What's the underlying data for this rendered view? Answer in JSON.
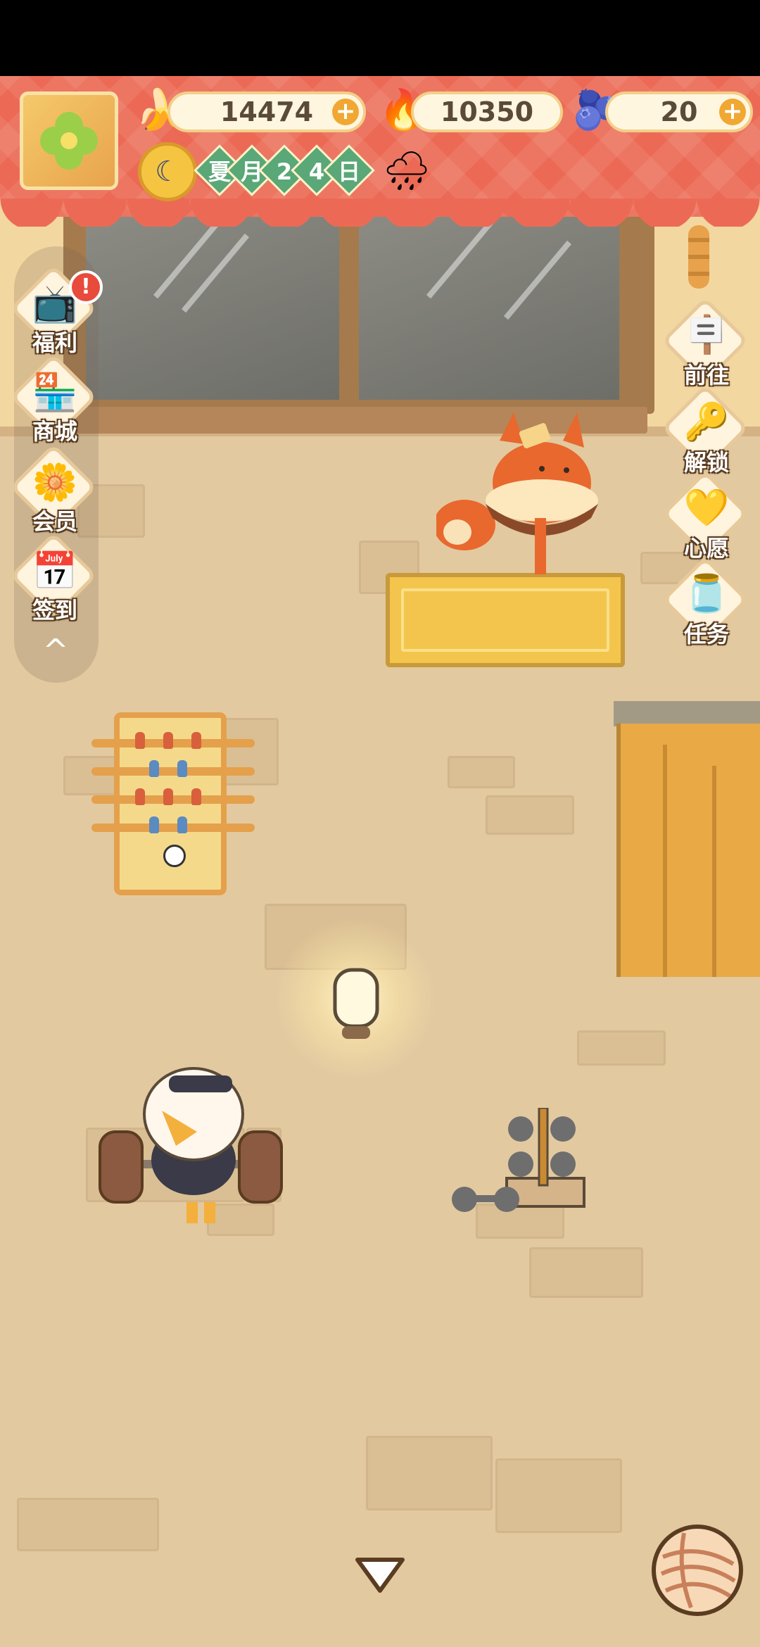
{
  "hud": {
    "bananas": "14474",
    "flames": "10350",
    "gems": "20",
    "plus_symbol": "+",
    "date": {
      "season": "夏",
      "month_word": "月",
      "day_a": "2",
      "day_b": "4",
      "day_word": "日"
    },
    "icons": {
      "avatar": "clover-flower-icon",
      "banana": "banana-icon",
      "flame": "flame-icon",
      "gem": "blue-banana-icon",
      "clock": "moon-clock-icon",
      "weather": "rain-cloud-icon"
    }
  },
  "left_menu": {
    "items": [
      {
        "label": "福利",
        "icon": "tv-icon",
        "badge": "!"
      },
      {
        "label": "商城",
        "icon": "shop-icon"
      },
      {
        "label": "会员",
        "icon": "flower-crown-icon"
      },
      {
        "label": "签到",
        "icon": "calendar-icon"
      }
    ],
    "collapse_symbol": "^"
  },
  "right_menu": {
    "items": [
      {
        "label": "前往",
        "icon": "signboard-icon"
      },
      {
        "label": "解锁",
        "icon": "key-icon"
      },
      {
        "label": "心愿",
        "icon": "heart-book-icon"
      },
      {
        "label": "任务",
        "icon": "task-jar-icon"
      }
    ]
  },
  "colors": {
    "hud_red": "#ec6a55",
    "wall": "#f3d7a0",
    "floor": "#e3c9a0",
    "date_green": "#5aa777"
  }
}
